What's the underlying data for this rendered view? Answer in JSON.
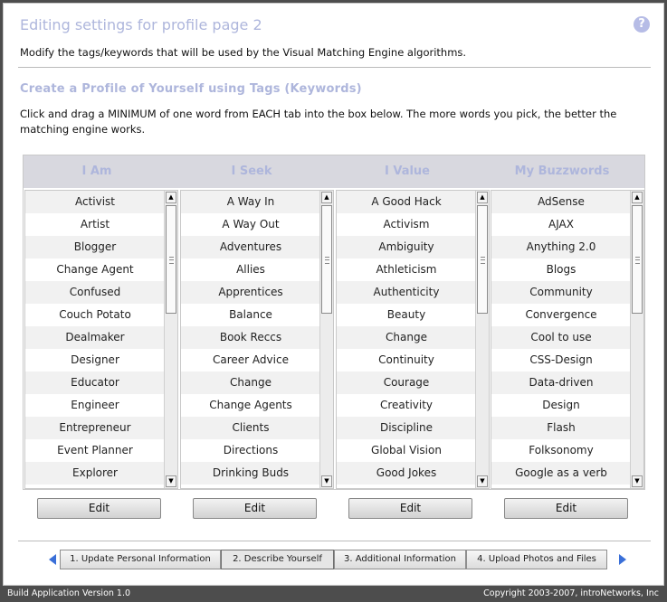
{
  "header": {
    "title": "Editing settings for profile page 2",
    "help_icon": "?",
    "description": "Modify the tags/keywords that will be used by the Visual Matching Engine algorithms."
  },
  "section": {
    "title": "Create a Profile of Yourself using Tags (Keywords)",
    "instructions": "Click and drag a MINIMUM of one word from EACH tab into the box below. The more words you pick, the better the matching engine works."
  },
  "columns": [
    {
      "title": "I Am",
      "items": [
        "Activist",
        "Artist",
        "Blogger",
        "Change Agent",
        "Confused",
        "Couch Potato",
        "Dealmaker",
        "Designer",
        "Educator",
        "Engineer",
        "Entrepreneur",
        "Event Planner",
        "Explorer"
      ],
      "edit_label": "Edit"
    },
    {
      "title": "I Seek",
      "items": [
        "A Way In",
        "A Way Out",
        "Adventures",
        "Allies",
        "Apprentices",
        "Balance",
        "Book Reccs",
        "Career Advice",
        "Change",
        "Change Agents",
        "Clients",
        "Directions",
        "Drinking Buds"
      ],
      "edit_label": "Edit"
    },
    {
      "title": "I Value",
      "items": [
        "A Good Hack",
        "Activism",
        "Ambiguity",
        "Athleticism",
        "Authenticity",
        "Beauty",
        "Change",
        "Continuity",
        "Courage",
        "Creativity",
        "Discipline",
        "Global Vision",
        "Good Jokes"
      ],
      "edit_label": "Edit"
    },
    {
      "title": "My Buzzwords",
      "items": [
        "AdSense",
        "AJAX",
        "Anything 2.0",
        "Blogs",
        "Community",
        "Convergence",
        "Cool to use",
        "CSS-Design",
        "Data-driven",
        "Design",
        "Flash",
        "Folksonomy",
        "Google as a verb"
      ],
      "edit_label": "Edit"
    }
  ],
  "wizard": {
    "steps": [
      "1. Update Personal Information",
      "2. Describe Yourself",
      "3. Additional Information",
      "4. Upload Photos and Files"
    ],
    "active_step": 2
  },
  "footer": {
    "version": "Build Application Version 1.0",
    "copyright": "Copyright 2003-2007, introNetworks, Inc"
  },
  "colors": {
    "accent": "#aeb6dc",
    "nav_arrow": "#3a6fd8",
    "frame": "#4d4d4d"
  }
}
